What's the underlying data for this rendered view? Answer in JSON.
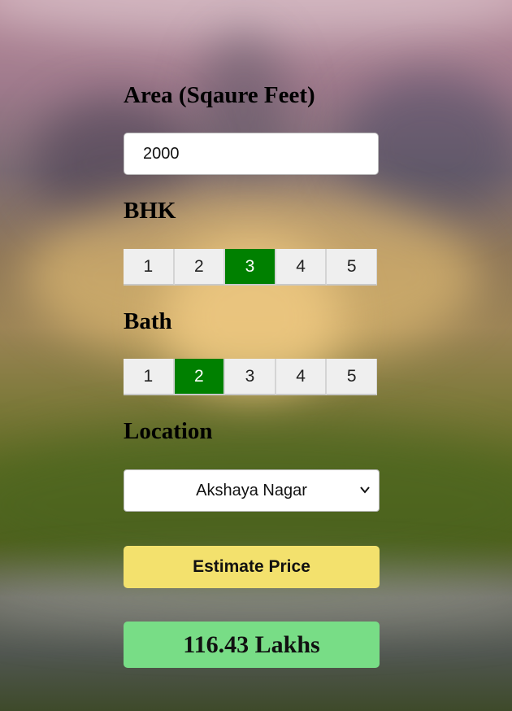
{
  "area": {
    "heading": "Area (Sqaure Feet)",
    "value": "2000"
  },
  "bhk": {
    "heading": "BHK",
    "options": [
      "1",
      "2",
      "3",
      "4",
      "5"
    ],
    "selected": "3"
  },
  "bath": {
    "heading": "Bath",
    "options": [
      "1",
      "2",
      "3",
      "4",
      "5"
    ],
    "selected": "2"
  },
  "location": {
    "heading": "Location",
    "selected": "Akshaya Nagar"
  },
  "estimate_button": {
    "label": "Estimate Price"
  },
  "result": {
    "text": "116.43 Lakhs"
  },
  "colors": {
    "selected_option": "#008000",
    "estimate_button": "#f3e16d",
    "result_box": "#78dd86"
  },
  "icons": {
    "select_arrow": "chevron-down-icon"
  }
}
